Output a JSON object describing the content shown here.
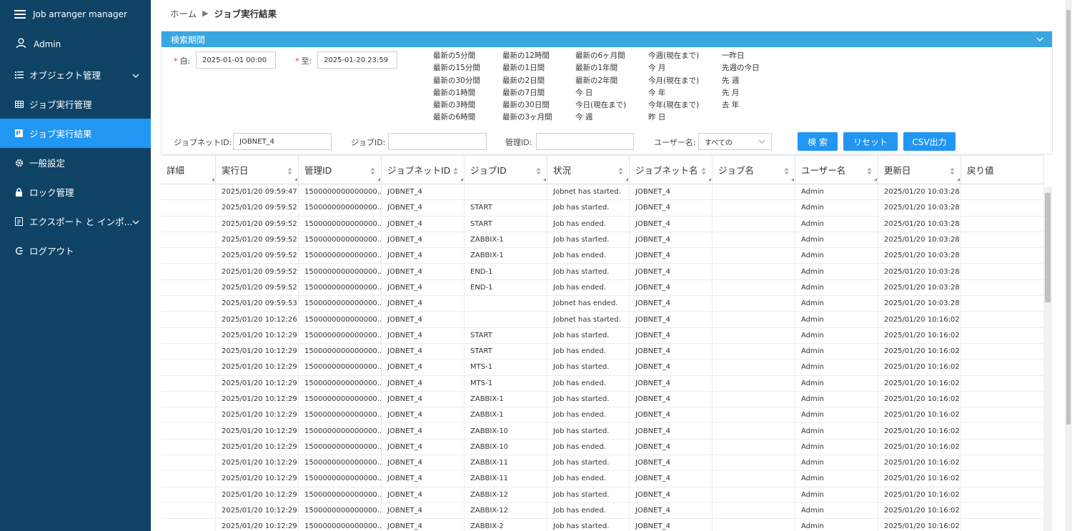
{
  "app": {
    "title": "Job arranger manager",
    "user": "Admin"
  },
  "sidebar": {
    "items": [
      {
        "label": "オブジェクト管理",
        "icon": "list-icon",
        "expandable": true
      },
      {
        "label": "ジョブ実行管理",
        "icon": "grid-icon",
        "expandable": false
      },
      {
        "label": "ジョブ実行結果",
        "icon": "kanban-icon",
        "expandable": false,
        "active": true
      },
      {
        "label": "一般設定",
        "icon": "gear-icon",
        "expandable": false
      },
      {
        "label": "ロック管理",
        "icon": "lock-icon",
        "expandable": false
      },
      {
        "label": "エクスポート と インポ...",
        "icon": "export-icon",
        "expandable": true
      },
      {
        "label": "ログアウト",
        "icon": "logout-icon",
        "expandable": false
      }
    ]
  },
  "breadcrumb": {
    "home": "ホーム",
    "current": "ジョブ実行結果"
  },
  "search": {
    "period_title": "検索期間",
    "from_label": "自:",
    "from_value": "2025-01-01 00:00",
    "to_label": "至:",
    "to_value": "2025-01-20 23:59",
    "quick": [
      [
        "最新の5分間",
        "最新の15分間",
        "最新の30分間",
        "最新の1時間",
        "最新の3時間",
        "最新の6時間"
      ],
      [
        "最新の12時間",
        "最新の1日間",
        "最新の2日間",
        "最新の7日間",
        "最新の30日間",
        "最新の3ヶ月間"
      ],
      [
        "最新の6ヶ月間",
        "最新の1年間",
        "最新の2年間",
        "今 日",
        "今日(現在まで)",
        "今 週"
      ],
      [
        "今週(現在まで)",
        "今 月",
        "今月(現在まで)",
        "今 年",
        "今年(現在まで)",
        "昨 日"
      ],
      [
        "一昨日",
        "先週の今日",
        "先 週",
        "先 月",
        "去 年"
      ]
    ],
    "jobnet_id_label": "ジョブネットID:",
    "jobnet_id_value": "JOBNET_4",
    "job_id_label": "ジョブID:",
    "job_id_value": "",
    "manage_id_label": "管理ID:",
    "manage_id_value": "",
    "user_label": "ユーザー名:",
    "user_value": "すべての",
    "search_button": "検 索",
    "reset_button": "リセット",
    "csv_button": "CSV出力",
    "accent_color": "#2196f3"
  },
  "table": {
    "columns": [
      "詳細",
      "実行日",
      "管理ID",
      "ジョブネットID",
      "ジョブID",
      "状況",
      "ジョブネット名",
      "ジョブ名",
      "ユーザー名",
      "更新日",
      "戻り値"
    ],
    "rows": [
      [
        "",
        "2025/01/20 09:59:47",
        "1500000000000000...",
        "JOBNET_4",
        "",
        "Jobnet has started.",
        "JOBNET_4",
        "",
        "Admin",
        "2025/01/20 10:03:28",
        ""
      ],
      [
        "",
        "2025/01/20 09:59:52",
        "1500000000000000...",
        "JOBNET_4",
        "START",
        "Job has started.",
        "JOBNET_4",
        "",
        "Admin",
        "2025/01/20 10:03:28",
        ""
      ],
      [
        "",
        "2025/01/20 09:59:52",
        "1500000000000000...",
        "JOBNET_4",
        "START",
        "Job has ended.",
        "JOBNET_4",
        "",
        "Admin",
        "2025/01/20 10:03:28",
        ""
      ],
      [
        "",
        "2025/01/20 09:59:52",
        "1500000000000000...",
        "JOBNET_4",
        "ZABBIX-1",
        "Job has started.",
        "JOBNET_4",
        "",
        "Admin",
        "2025/01/20 10:03:28",
        ""
      ],
      [
        "",
        "2025/01/20 09:59:52",
        "1500000000000000...",
        "JOBNET_4",
        "ZABBIX-1",
        "Job has ended.",
        "JOBNET_4",
        "",
        "Admin",
        "2025/01/20 10:03:28",
        ""
      ],
      [
        "",
        "2025/01/20 09:59:52",
        "1500000000000000...",
        "JOBNET_4",
        "END-1",
        "Job has started.",
        "JOBNET_4",
        "",
        "Admin",
        "2025/01/20 10:03:28",
        ""
      ],
      [
        "",
        "2025/01/20 09:59:52",
        "1500000000000000...",
        "JOBNET_4",
        "END-1",
        "Job has ended.",
        "JOBNET_4",
        "",
        "Admin",
        "2025/01/20 10:03:28",
        ""
      ],
      [
        "",
        "2025/01/20 09:59:53",
        "1500000000000000...",
        "JOBNET_4",
        "",
        "Jobnet has ended.",
        "JOBNET_4",
        "",
        "Admin",
        "2025/01/20 10:03:28",
        ""
      ],
      [
        "",
        "2025/01/20 10:12:26",
        "1500000000000000...",
        "JOBNET_4",
        "",
        "Jobnet has started.",
        "JOBNET_4",
        "",
        "Admin",
        "2025/01/20 10:16:02",
        ""
      ],
      [
        "",
        "2025/01/20 10:12:29",
        "1500000000000000...",
        "JOBNET_4",
        "START",
        "Job has started.",
        "JOBNET_4",
        "",
        "Admin",
        "2025/01/20 10:16:02",
        ""
      ],
      [
        "",
        "2025/01/20 10:12:29",
        "1500000000000000...",
        "JOBNET_4",
        "START",
        "Job has ended.",
        "JOBNET_4",
        "",
        "Admin",
        "2025/01/20 10:16:02",
        ""
      ],
      [
        "",
        "2025/01/20 10:12:29",
        "1500000000000000...",
        "JOBNET_4",
        "MTS-1",
        "Job has started.",
        "JOBNET_4",
        "",
        "Admin",
        "2025/01/20 10:16:02",
        ""
      ],
      [
        "",
        "2025/01/20 10:12:29",
        "1500000000000000...",
        "JOBNET_4",
        "MTS-1",
        "Job has ended.",
        "JOBNET_4",
        "",
        "Admin",
        "2025/01/20 10:16:02",
        ""
      ],
      [
        "",
        "2025/01/20 10:12:29",
        "1500000000000000...",
        "JOBNET_4",
        "ZABBIX-1",
        "Job has started.",
        "JOBNET_4",
        "",
        "Admin",
        "2025/01/20 10:16:02",
        ""
      ],
      [
        "",
        "2025/01/20 10:12:29",
        "1500000000000000...",
        "JOBNET_4",
        "ZABBIX-1",
        "Job has ended.",
        "JOBNET_4",
        "",
        "Admin",
        "2025/01/20 10:16:02",
        ""
      ],
      [
        "",
        "2025/01/20 10:12:29",
        "1500000000000000...",
        "JOBNET_4",
        "ZABBIX-10",
        "Job has started.",
        "JOBNET_4",
        "",
        "Admin",
        "2025/01/20 10:16:02",
        ""
      ],
      [
        "",
        "2025/01/20 10:12:29",
        "1500000000000000...",
        "JOBNET_4",
        "ZABBIX-10",
        "Job has ended.",
        "JOBNET_4",
        "",
        "Admin",
        "2025/01/20 10:16:02",
        ""
      ],
      [
        "",
        "2025/01/20 10:12:29",
        "1500000000000000...",
        "JOBNET_4",
        "ZABBIX-11",
        "Job has started.",
        "JOBNET_4",
        "",
        "Admin",
        "2025/01/20 10:16:02",
        ""
      ],
      [
        "",
        "2025/01/20 10:12:29",
        "1500000000000000...",
        "JOBNET_4",
        "ZABBIX-11",
        "Job has ended.",
        "JOBNET_4",
        "",
        "Admin",
        "2025/01/20 10:16:02",
        ""
      ],
      [
        "",
        "2025/01/20 10:12:29",
        "1500000000000000...",
        "JOBNET_4",
        "ZABBIX-12",
        "Job has started.",
        "JOBNET_4",
        "",
        "Admin",
        "2025/01/20 10:16:02",
        ""
      ],
      [
        "",
        "2025/01/20 10:12:29",
        "1500000000000000...",
        "JOBNET_4",
        "ZABBIX-12",
        "Job has ended.",
        "JOBNET_4",
        "",
        "Admin",
        "2025/01/20 10:16:02",
        ""
      ],
      [
        "",
        "2025/01/20 10:12:29",
        "1500000000000000...",
        "JOBNET_4",
        "ZABBIX-2",
        "Job has started.",
        "JOBNET_4",
        "",
        "Admin",
        "2025/01/20 10:16:02",
        ""
      ]
    ]
  },
  "colors": {
    "sidebar_bg": "#0f4366",
    "active": "#2196f3",
    "panel_head": "#3aa6e0"
  }
}
